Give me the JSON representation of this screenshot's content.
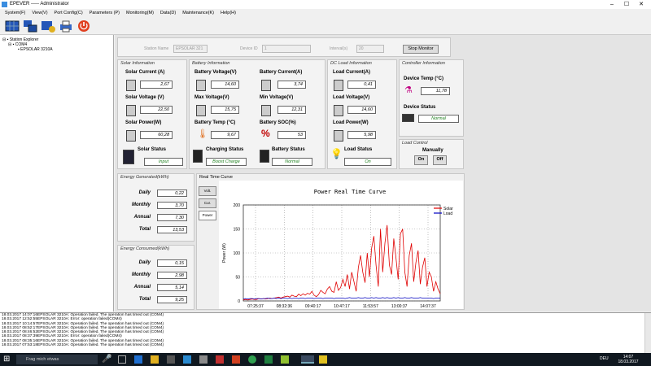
{
  "window": {
    "title": "EPEVER ----- Administrator"
  },
  "menu": [
    "System(F)",
    "View(V)",
    "Port Config(C)",
    "Parameters (P)",
    "Monitoring(M)",
    "Data(D)",
    "Maintenance(K)",
    "Help(H)"
  ],
  "tree": {
    "root": "Station Explorer",
    "port": "COM4",
    "device": "EPSOLAR 3210A"
  },
  "header": {
    "station_name_label": "Station Name",
    "station_name_value": "EPSOLAR 321",
    "device_id_label": "Device ID",
    "device_id_value": "1",
    "interval_label": "Interval(s)",
    "interval_value": "20",
    "stop_button": "Stop Monitor"
  },
  "solar": {
    "title": "Solar Information",
    "current_label": "Solar Current (A)",
    "current": "2,67",
    "voltage_label": "Solar Voltage (V)",
    "voltage": "22,50",
    "power_label": "Solar Power(W)",
    "power": "60,28",
    "status_label": "Solar Status",
    "status": "Input"
  },
  "battery": {
    "title": "Battery Information",
    "voltage_label": "Battery Voltage(V)",
    "voltage": "14,60",
    "current_label": "Battery Current(A)",
    "current": "3,74",
    "max_label": "Max Voltage(V)",
    "max": "15,75",
    "min_label": "Min Voltage(V)",
    "min": "12,31",
    "temp_label": "Battery Temp (°C)",
    "temp": "9,67",
    "soc_label": "Battery SOC(%)",
    "soc": "53",
    "charging_label": "Charging Status",
    "charging": "Boost Charge",
    "status_label": "Battery Status",
    "status": "Normal"
  },
  "dcload": {
    "title": "DC Load Information",
    "current_label": "Load Current(A)",
    "current": "0,41",
    "voltage_label": "Load Voltage(V)",
    "voltage": "14,60",
    "power_label": "Load Power(W)",
    "power": "5,98",
    "status_label": "Load Status",
    "status": "On"
  },
  "controller": {
    "title": "Controller Information",
    "temp_label": "Device Temp (°C)",
    "temp": "11,78",
    "status_label": "Device Status",
    "status": "Normal"
  },
  "loadcontrol": {
    "title": "Load Control",
    "manually": "Manually",
    "on": "On",
    "off": "Off"
  },
  "energy_gen": {
    "title": "Energy Generated(kWh)",
    "rows": [
      {
        "label": "Daily",
        "value": "0,22"
      },
      {
        "label": "Monthly",
        "value": "3,70"
      },
      {
        "label": "Annual",
        "value": "7,30"
      },
      {
        "label": "Total",
        "value": "13,53"
      }
    ]
  },
  "energy_con": {
    "title": "Energy Consumed(kWh)",
    "rows": [
      {
        "label": "Daily",
        "value": "0,15"
      },
      {
        "label": "Monthly",
        "value": "2,98"
      },
      {
        "label": "Annual",
        "value": "5,14"
      },
      {
        "label": "Total",
        "value": "9,25"
      }
    ]
  },
  "realtime": {
    "title": "Real Time Curve",
    "tabs": [
      "Volt.",
      "Cur.",
      "Power"
    ]
  },
  "chart_data": {
    "type": "line",
    "title": "Power Real Time Curve",
    "xlabel": "",
    "ylabel": "Power (W)",
    "ylim": [
      0,
      200
    ],
    "yticks": [
      0,
      50,
      100,
      150,
      200
    ],
    "xticks": [
      "07:25:37",
      "08:32:36",
      "09:40:17",
      "10:47:17",
      "11:53:57",
      "13:00:37",
      "14:07:37"
    ],
    "legend": "top-right",
    "grid": true,
    "series": [
      {
        "name": "Solar",
        "color": "#e00000",
        "values": [
          2,
          3,
          2,
          3,
          4,
          3,
          3,
          5,
          4,
          5,
          4,
          5,
          6,
          5,
          6,
          7,
          8,
          6,
          8,
          9,
          10,
          8,
          12,
          10,
          9,
          14,
          11,
          15,
          12,
          16,
          14,
          20,
          12,
          9,
          13,
          22,
          18,
          15,
          25,
          30,
          20,
          18,
          40,
          22,
          28,
          45,
          30,
          55,
          25,
          60,
          40,
          20,
          70,
          95,
          60,
          38,
          100,
          50,
          110,
          135,
          75,
          30,
          150,
          60,
          120,
          158,
          75,
          55,
          130,
          90,
          45,
          140,
          150,
          60,
          30,
          95,
          120,
          40,
          80,
          105,
          35,
          70,
          90,
          30,
          60,
          50,
          20,
          40,
          25,
          15
        ]
      },
      {
        "name": "Load",
        "color": "#0000c0",
        "values": [
          4,
          5,
          4,
          5,
          5,
          4,
          5,
          5,
          4,
          5,
          5,
          6,
          5,
          5,
          6,
          5,
          6,
          5,
          6,
          6,
          5,
          6,
          5,
          6,
          6,
          5,
          6,
          6,
          5,
          6,
          6,
          6,
          5,
          6,
          6,
          6,
          5,
          6,
          6,
          6,
          6,
          5,
          6,
          6,
          6,
          6,
          5,
          6,
          7,
          6,
          6,
          6,
          7,
          6,
          6,
          7,
          6,
          6,
          7,
          6,
          7,
          6,
          6,
          7,
          6,
          7,
          6,
          6,
          7,
          6,
          7,
          6,
          6,
          7,
          6,
          6,
          7,
          6,
          6,
          6,
          7,
          6,
          6,
          6,
          6,
          6,
          5,
          6,
          6,
          6
        ]
      }
    ]
  },
  "log": [
    "18.03.2017 14:07:16EPSOLAR 3210A: Operation failed. The operation has timed out (COM4)",
    "18.03.2017 12:52:55EPSOLAR 3210A: Error: operation failed(COM4)",
    "18.03.2017 10:14:57EPSOLAR 3210A: Operation failed. The operation has timed out (COM4)",
    "18.03.2017 08:52:17EPSOLAR 3210A: Operation failed. The operation has timed out (COM4)",
    "18.03.2017 08:46:52EPSOLAR 3210A: Operation failed. The operation has timed out (COM4)",
    "18.03.2017 08:37:39EPSOLAR 3210A: Error: operation failed(COM4)",
    "18.03.2017 08:35:16EPSOLAR 3210A: Operation failed. The operation has timed out (COM4)",
    "18.03.2017 07:53:18EPSOLAR 3210A: Operation failed. The operation has timed out (COM4)"
  ],
  "taskbar": {
    "search": "Frag mich etwas",
    "lang": "DEU",
    "time": "14:07",
    "date": "18.03.2017"
  }
}
